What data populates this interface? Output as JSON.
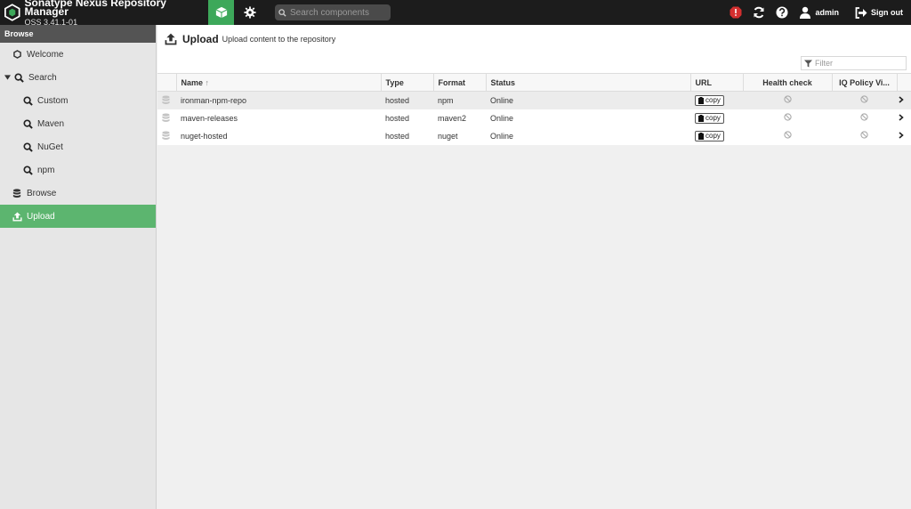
{
  "header": {
    "app_title": "Sonatype Nexus Repository Manager",
    "version": "OSS 3.41.1-01",
    "search_placeholder": "Search components",
    "user_label": "admin",
    "signout_label": "Sign out"
  },
  "colors": {
    "accent": "#3da85a",
    "active_nav": "#5cb56f",
    "topbar": "#1c1c1c",
    "alert": "#d32f2f"
  },
  "sidebar": {
    "header": "Browse",
    "items": [
      {
        "label": "Welcome",
        "icon": "hexagon-icon"
      },
      {
        "label": "Search",
        "icon": "search-icon"
      },
      {
        "label": "Custom",
        "icon": "search-icon"
      },
      {
        "label": "Maven",
        "icon": "search-icon"
      },
      {
        "label": "NuGet",
        "icon": "search-icon"
      },
      {
        "label": "npm",
        "icon": "search-icon"
      },
      {
        "label": "Browse",
        "icon": "database-icon"
      },
      {
        "label": "Upload",
        "icon": "upload-icon"
      }
    ]
  },
  "panel": {
    "title": "Upload",
    "subtitle": "Upload content to the repository",
    "filter_placeholder": "Filter"
  },
  "table": {
    "columns": {
      "name": "Name",
      "name_sort": "↑",
      "type": "Type",
      "format": "Format",
      "status": "Status",
      "url": "URL",
      "health": "Health check",
      "iq": "IQ Policy Vi..."
    },
    "copy_label": "copy",
    "rows": [
      {
        "name": "ironman-npm-repo",
        "type": "hosted",
        "format": "npm",
        "status": "Online"
      },
      {
        "name": "maven-releases",
        "type": "hosted",
        "format": "maven2",
        "status": "Online"
      },
      {
        "name": "nuget-hosted",
        "type": "hosted",
        "format": "nuget",
        "status": "Online"
      }
    ]
  }
}
